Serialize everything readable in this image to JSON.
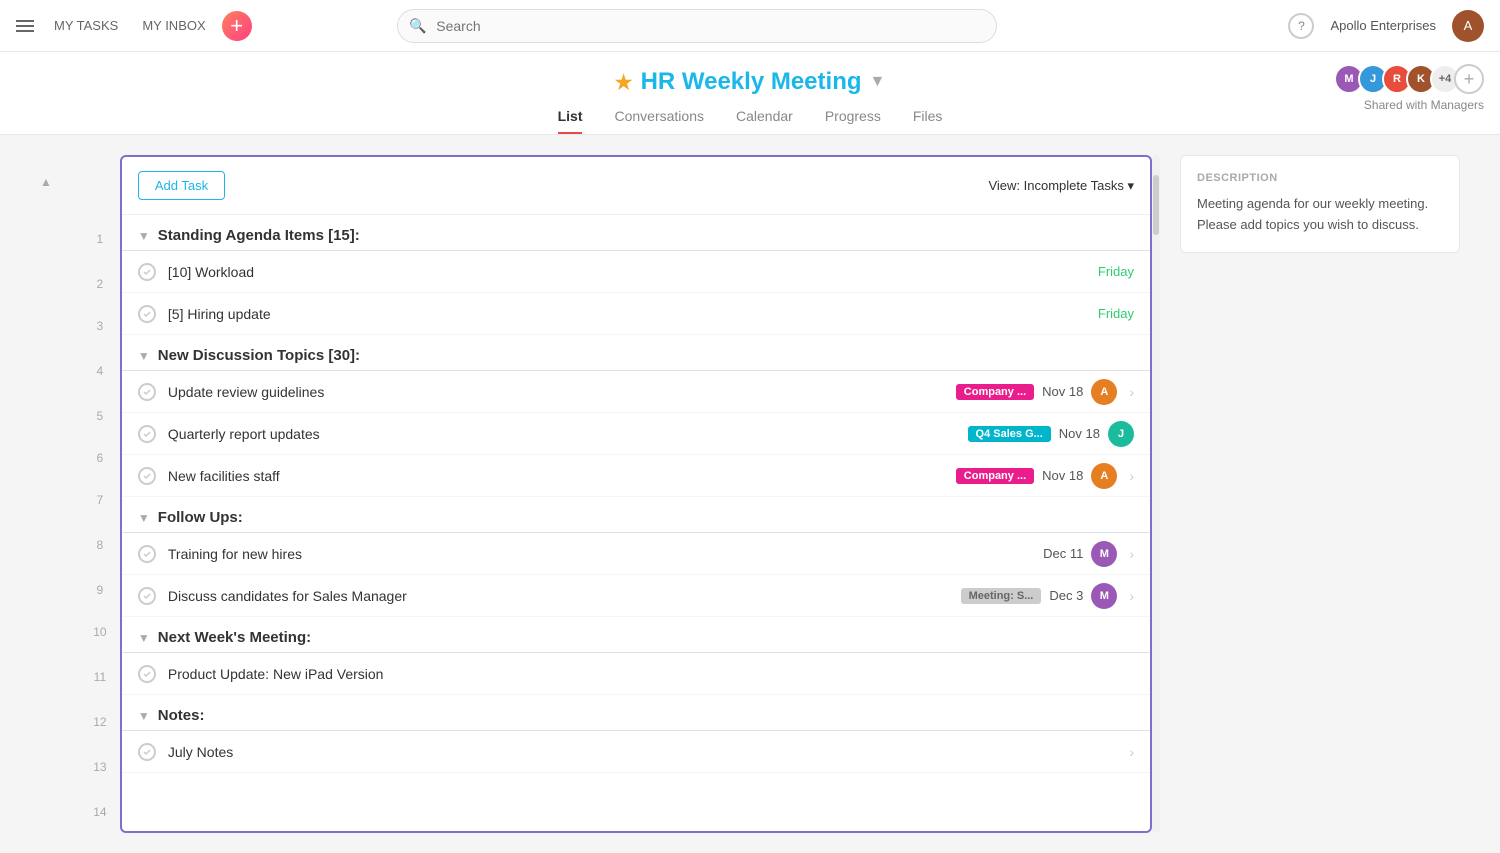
{
  "nav": {
    "my_tasks": "MY TASKS",
    "my_inbox": "MY INBOX",
    "search_placeholder": "Search",
    "user_name": "Apollo Enterprises",
    "help": "?"
  },
  "project": {
    "title": "HR Weekly Meeting",
    "title_dropdown": "▾",
    "tabs": [
      "List",
      "Conversations",
      "Calendar",
      "Progress",
      "Files"
    ],
    "active_tab": "List",
    "shared_label": "Shared with Managers"
  },
  "toolbar": {
    "add_task": "Add Task",
    "view_label": "View: Incomplete Tasks",
    "view_chevron": "▾"
  },
  "description": {
    "label": "DESCRIPTION",
    "text": "Meeting agenda for our weekly meeting. Please add topics you wish to discuss."
  },
  "sections": [
    {
      "id": 1,
      "row_num": "1",
      "label": "Standing Agenda Items [15]:",
      "tasks": [
        {
          "row": "2",
          "name": "[10] Workload",
          "date": "Friday",
          "date_class": "green",
          "tag": null,
          "avatar_color": null
        },
        {
          "row": "3",
          "name": "[5] Hiring update",
          "date": "Friday",
          "date_class": "green",
          "tag": null,
          "avatar_color": null
        }
      ]
    },
    {
      "id": 4,
      "row_num": "4",
      "label": "New Discussion Topics [30]:",
      "tasks": [
        {
          "row": "5",
          "name": "Update review guidelines",
          "date": "Nov 18",
          "date_class": "dark",
          "tag": "Company ...",
          "tag_class": "tag-pink",
          "avatar_color": "av-orange",
          "chevron": true
        },
        {
          "row": "6",
          "name": "Quarterly report updates",
          "date": "Nov 18",
          "date_class": "dark",
          "tag": "Q4 Sales G...",
          "tag_class": "tag-teal",
          "avatar_color": "av-teal",
          "chevron": false
        },
        {
          "row": "7",
          "name": "New facilities staff",
          "date": "Nov 18",
          "date_class": "dark",
          "tag": "Company ...",
          "tag_class": "tag-pink",
          "avatar_color": "av-orange",
          "chevron": true
        }
      ]
    },
    {
      "id": 8,
      "row_num": "8",
      "label": "Follow Ups:",
      "tasks": [
        {
          "row": "9",
          "name": "Training for new hires",
          "date": "Dec 11",
          "date_class": "dark",
          "tag": null,
          "avatar_color": "av-purple",
          "chevron": true
        },
        {
          "row": "10",
          "name": "Discuss candidates for Sales Manager",
          "date": "Dec 3",
          "date_class": "dark",
          "tag": "Meeting: S...",
          "tag_class": "tag-gray",
          "avatar_color": "av-purple",
          "chevron": true
        }
      ]
    },
    {
      "id": 11,
      "row_num": "11",
      "label": "Next Week's Meeting:",
      "tasks": [
        {
          "row": "12",
          "name": "Product Update: New iPad Version",
          "date": null,
          "tag": null,
          "avatar_color": null
        }
      ]
    },
    {
      "id": 13,
      "row_num": "13",
      "label": "Notes:",
      "tasks": [
        {
          "row": "14",
          "name": "July Notes",
          "date": null,
          "tag": null,
          "avatar_color": null,
          "chevron": true
        }
      ]
    }
  ]
}
